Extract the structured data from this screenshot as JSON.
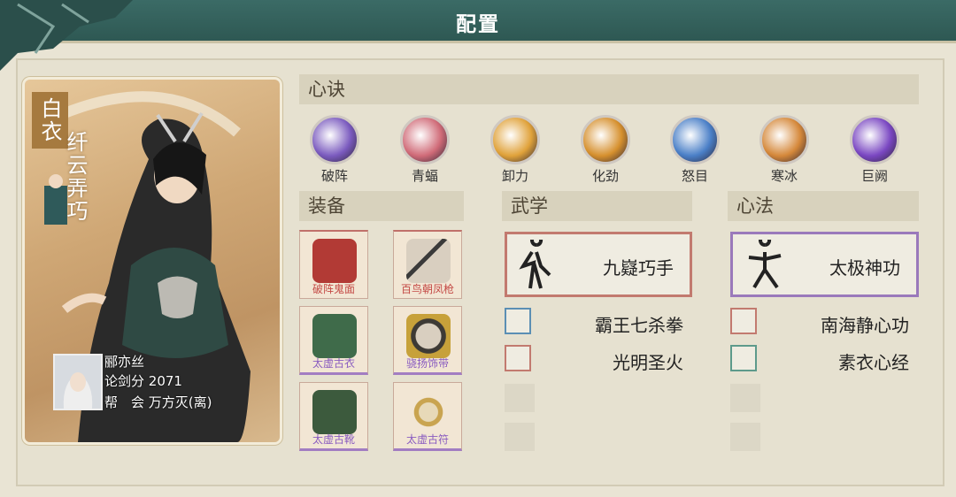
{
  "title": "配置",
  "character": {
    "title_part1": "白衣",
    "title_part2": "纤云弄巧",
    "name": "郦亦丝",
    "score_label": "论剑分",
    "score": "2071",
    "guild_label": "帮　会",
    "guild": "万方灭(离)"
  },
  "sections": {
    "xinjue": "心诀",
    "zhuangbei": "装备",
    "wuxue": "武学",
    "xinfa": "心法"
  },
  "skills": [
    {
      "name": "破阵",
      "color": "#7b5bbf"
    },
    {
      "name": "青蝠",
      "color": "#d06b78"
    },
    {
      "name": "卸力",
      "color": "#e0a23a"
    },
    {
      "name": "化劲",
      "color": "#d6902e"
    },
    {
      "name": "怒目",
      "color": "#4a7fc7"
    },
    {
      "name": "寒冰",
      "color": "#d5883a"
    },
    {
      "name": "巨阙",
      "color": "#7a47c2"
    }
  ],
  "equipment": [
    {
      "name": "破阵鬼面",
      "icon": "demon-mask-icon"
    },
    {
      "name": "百鸟朝凤枪",
      "icon": "spear-icon"
    },
    {
      "name": "太虚古衣",
      "icon": "robe-icon"
    },
    {
      "name": "骁扬饰带",
      "icon": "belt-icon"
    },
    {
      "name": "太虚古靴",
      "icon": "boots-icon"
    },
    {
      "name": "太虚古符",
      "icon": "amulet-icon"
    }
  ],
  "wuxue": {
    "main": "九嶷巧手",
    "items": [
      "霸王七杀拳",
      "光明圣火"
    ]
  },
  "xinfa": {
    "main": "太极神功",
    "items": [
      "南海静心功",
      "素衣心经"
    ]
  }
}
